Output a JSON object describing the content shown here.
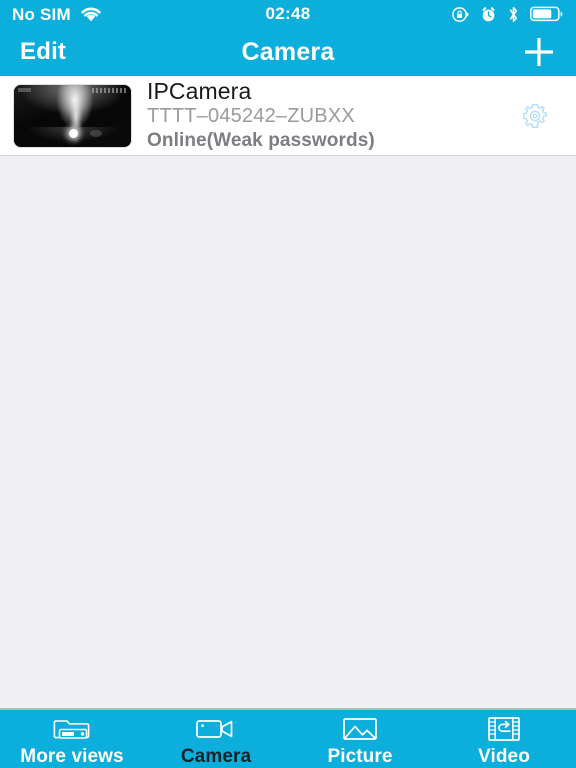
{
  "status_bar": {
    "carrier": "No SIM",
    "wifi_icon": "wifi-icon",
    "time": "02:48",
    "right_icons": [
      {
        "name": "rotation-lock-icon"
      },
      {
        "name": "alarm-clock-icon"
      },
      {
        "name": "bluetooth-icon"
      },
      {
        "name": "battery-icon"
      }
    ]
  },
  "nav_bar": {
    "edit_label": "Edit",
    "title": "Camera",
    "add_icon": "plus-icon"
  },
  "camera_list": {
    "items": [
      {
        "name": "IPCamera",
        "id": "TTTT–045242–ZUBXX",
        "status": "Online(Weak passwords)",
        "thumbnail": "camera-snapshot-thumbnail",
        "settings_icon": "gear-icon"
      }
    ]
  },
  "tab_bar": {
    "tabs": [
      {
        "label": "More views",
        "icon": "dvr-folder-icon",
        "active": false
      },
      {
        "label": "Camera",
        "icon": "camcorder-icon",
        "active": true
      },
      {
        "label": "Picture",
        "icon": "photo-icon",
        "active": false
      },
      {
        "label": "Video",
        "icon": "film-replay-icon",
        "active": false
      }
    ]
  },
  "colors": {
    "brand": "#0CAEDC",
    "page_background": "#EFEFF4",
    "row_background": "#FFFFFF",
    "id_text": "#9A9A9F",
    "status_text": "#7D7D82",
    "active_tab_label": "#15232B"
  }
}
